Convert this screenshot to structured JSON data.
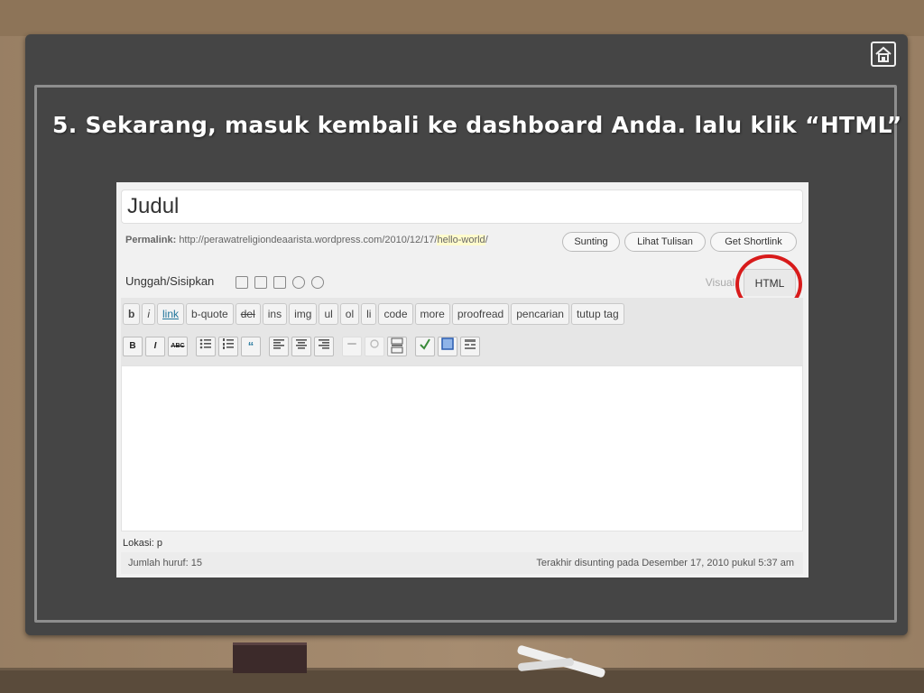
{
  "slide": {
    "title": "5. Sekarang, masuk kembali ke dashboard Anda. lalu klik “HTML”",
    "home_icon": "home-icon"
  },
  "editor": {
    "post_title": "Judul",
    "permalink_label": "Permalink:",
    "permalink_base": "http://perawatreligiondeaarista.wordpress.com/2010/12/17/",
    "permalink_slug": "hello-world",
    "permalink_trailing": "/",
    "buttons": {
      "edit": "Sunting",
      "view": "Lihat Tulisan",
      "shortlink": "Get Shortlink"
    },
    "upload_label": "Unggah/Sisipkan",
    "tabs": {
      "visual": "Visual",
      "html": "HTML"
    },
    "quicktags": [
      "b",
      "i",
      "link",
      "b-quote",
      "del",
      "ins",
      "img",
      "ul",
      "ol",
      "li",
      "code",
      "more",
      "proofread",
      "pencarian",
      "tutup tag"
    ],
    "format_buttons": {
      "bold": "B",
      "italic": "I",
      "strike": "ABC",
      "quote": "“"
    },
    "path_label": "Lokasi: p",
    "word_count": "Jumlah huruf: 15",
    "last_edited": "Terakhir disunting pada Desember 17, 2010 pukul 5:37 am"
  },
  "colors": {
    "board": "#454545",
    "highlight_circle": "#d81b1b",
    "link": "#21759b"
  }
}
